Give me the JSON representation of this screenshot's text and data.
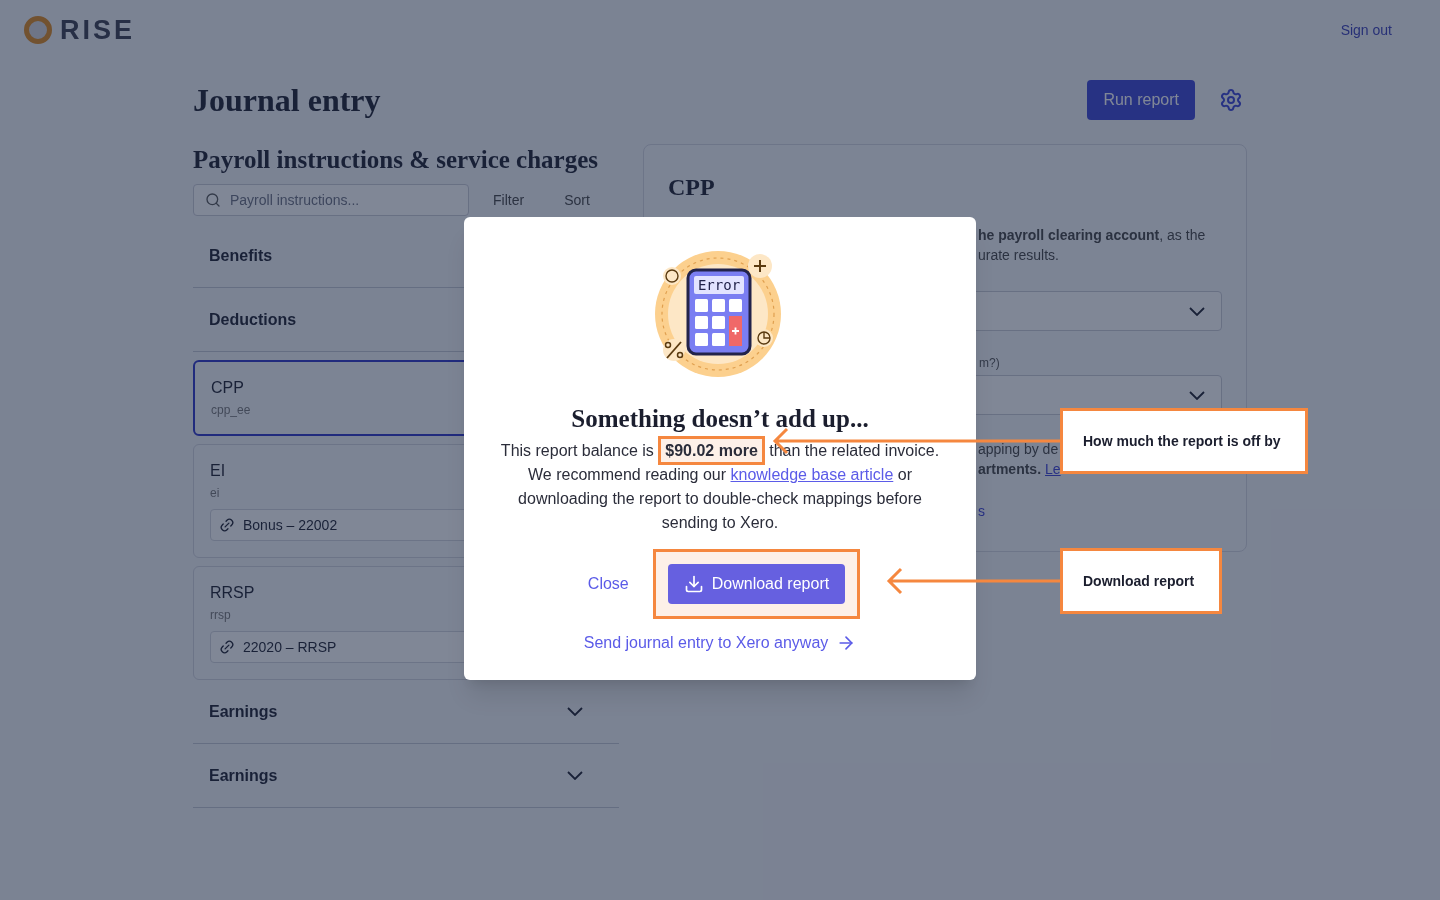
{
  "header": {
    "logo": "RISE",
    "sign_out": "Sign out"
  },
  "page": {
    "title": "Journal entry",
    "run_button": "Run report"
  },
  "left_panel": {
    "title": "Payroll instructions & service charges",
    "search": {
      "placeholder": "Payroll instructions..."
    },
    "filter": "Filter",
    "sort": "Sort",
    "items": [
      {
        "kind": "section",
        "label": "Benefits"
      },
      {
        "kind": "section",
        "label": "Deductions"
      },
      {
        "kind": "card",
        "label": "CPP",
        "code": "cpp_ee",
        "selected": true
      },
      {
        "kind": "card",
        "label": "EI",
        "code": "ei",
        "selected": false,
        "account": "Bonus – 22002"
      },
      {
        "kind": "card",
        "label": "RRSP",
        "code": "rrsp",
        "selected": false,
        "account": "22020 – RRSP"
      },
      {
        "kind": "section",
        "label": "Earnings"
      },
      {
        "kind": "section",
        "label": "Earnings"
      }
    ]
  },
  "right_panel": {
    "title": "CPP",
    "intro_lines": [
      "**he payroll clearing account**, as the",
      "urate results."
    ],
    "field_label": "m?)",
    "note_line": "apping by de",
    "note_bold": "artments.",
    "note_link": "Le",
    "footer_link": "s"
  },
  "modal": {
    "illustration_text": "Error",
    "title": "Something doesn’t add up...",
    "message": {
      "before": "This report balance is ",
      "amount": "$90.02 more",
      "amount_highlighted": true,
      "after": " than the related invoice. We recommend reading our ",
      "link": "knowledge base article",
      "end": " or downloading the report to double-check mappings before sending to Xero."
    },
    "close": "Close",
    "download": {
      "label": "Download report",
      "highlighted": true
    },
    "send_link": "Send journal entry to Xero anyway"
  },
  "annotations": [
    {
      "label": "How much the report is off by"
    },
    {
      "label": "Download report"
    }
  ]
}
